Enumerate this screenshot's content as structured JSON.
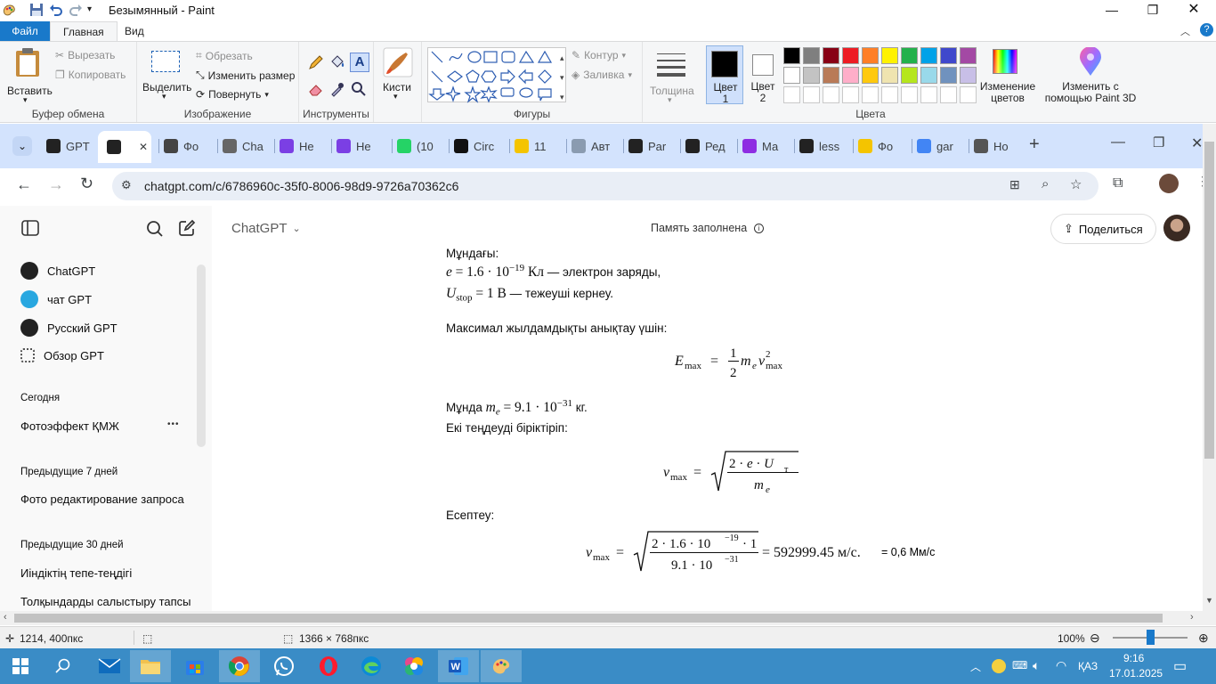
{
  "paint": {
    "title": "Безымянный - Paint",
    "tabs": {
      "file": "Файл",
      "home": "Главная",
      "view": "Вид"
    },
    "clipboard": {
      "paste": "Вставить",
      "cut": "Вырезать",
      "copy": "Копировать",
      "label": "Буфер обмена"
    },
    "image": {
      "select": "Выделить",
      "crop": "Обрезать",
      "resize": "Изменить размер",
      "rotate": "Повернуть",
      "label": "Изображение"
    },
    "tools": {
      "label": "Инструменты"
    },
    "brushes": {
      "label": "Кисти"
    },
    "shapes": {
      "outline": "Контур",
      "fill": "Заливка",
      "label": "Фигуры"
    },
    "size": {
      "label": "Толщина"
    },
    "colors": {
      "color1": "Цвет 1",
      "color2": "Цвет 2",
      "edit": "Изменение цветов",
      "label": "Цвета",
      "row1": [
        "#000000",
        "#7f7f7f",
        "#880015",
        "#ed1c24",
        "#ff7f27",
        "#fff200",
        "#22b14c",
        "#00a2e8",
        "#3f48cc",
        "#a349a4"
      ],
      "row2": [
        "#ffffff",
        "#c3c3c3",
        "#b97a57",
        "#ffaec9",
        "#ffc90e",
        "#efe4b0",
        "#b5e61d",
        "#99d9ea",
        "#7092be",
        "#c8bfe7"
      ]
    },
    "paint3d": "Изменить с помощью Paint 3D",
    "status": {
      "cursor": "1214, 400пкс",
      "size": "1366 × 768пкс",
      "zoom": "100%"
    }
  },
  "browser": {
    "tabs": [
      {
        "label": "GPT",
        "color": "#222222"
      },
      {
        "label": "",
        "color": "#222222"
      },
      {
        "label": "Фо",
        "color": "#444444"
      },
      {
        "label": "Cha",
        "color": "#666666"
      },
      {
        "label": "Не",
        "color": "#7b3fe4"
      },
      {
        "label": "Не",
        "color": "#7b3fe4"
      },
      {
        "label": "(10",
        "color": "#25d366"
      },
      {
        "label": "Circ",
        "color": "#111111"
      },
      {
        "label": "11",
        "color": "#f4c400"
      },
      {
        "label": "Авт",
        "color": "#8a9bb0"
      },
      {
        "label": "Par",
        "color": "#222222"
      },
      {
        "label": "Ред",
        "color": "#222222"
      },
      {
        "label": "Ма",
        "color": "#8e2de2"
      },
      {
        "label": "less",
        "color": "#222222"
      },
      {
        "label": "Фо",
        "color": "#f4c400"
      },
      {
        "label": "gar",
        "color": "#4285f4"
      },
      {
        "label": "Но",
        "color": "#555555"
      }
    ],
    "url": "chatgpt.com/c/6786960c-35f0-8006-98d9-9726a70362c6"
  },
  "chatgpt": {
    "model": "ChatGPT",
    "memory": "Память заполнена",
    "share": "Поделиться",
    "sidebar": {
      "gpts": [
        "ChatGPT",
        "чат GPT",
        "Русский GPT",
        "Обзор GPT"
      ],
      "today_head": "Сегодня",
      "today": [
        "Фотоэффект ҚМЖ"
      ],
      "week_head": "Предыдущие 7 дней",
      "week": [
        "Фото редактирование запроса"
      ],
      "month_head": "Предыдущие 30 дней",
      "month": [
        "Иіндіктің тепе-теңдігі",
        "Толқындарды салыстыру тапсы"
      ]
    },
    "content": {
      "line1": "Мұндағы:",
      "e_def": "— электрон заряды,",
      "u_def": "— тежеуші кернеу.",
      "max_speed": "Максимал жылдамдықты анықтау үшін:",
      "me_prefix": "Мұнда",
      "two_eq": "Екі теңдеуді біріктіріп:",
      "calc": "Есептеу:",
      "result_note": "= 0,6 Мм/с",
      "me_val": "9.1 · 10",
      "me_exp": "−31",
      "me_unit": "кг.",
      "e_val": "1.6 · 10",
      "e_exp": "−19",
      "e_unit": "Кл",
      "u_val": "1 В",
      "result_val": "= 592999.45 м/с."
    }
  },
  "taskbar": {
    "lang": "ҚАЗ",
    "time": "9:16",
    "date": "17.01.2025"
  }
}
